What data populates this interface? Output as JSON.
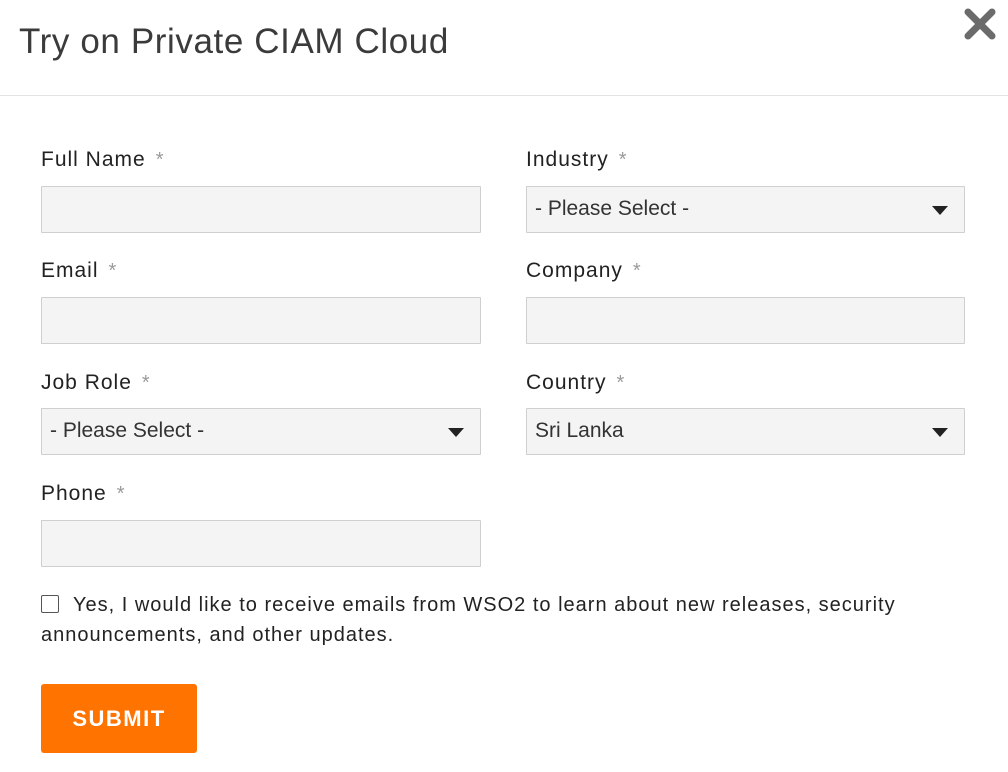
{
  "modal": {
    "title": "Try on Private CIAM Cloud",
    "close_icon": "close-icon"
  },
  "form": {
    "required_marker": "*",
    "full_name": {
      "label": "Full Name",
      "value": "",
      "placeholder": ""
    },
    "email": {
      "label": "Email",
      "value": "",
      "placeholder": ""
    },
    "job_role": {
      "label": "Job Role",
      "selected": "- Please Select -"
    },
    "phone": {
      "label": "Phone",
      "value": "",
      "placeholder": ""
    },
    "industry": {
      "label": "Industry",
      "selected": "- Please Select -"
    },
    "company": {
      "label": "Company",
      "value": "",
      "placeholder": ""
    },
    "country": {
      "label": "Country",
      "selected": "Sri Lanka"
    },
    "consent": {
      "checked": false,
      "text": "Yes, I would like to receive emails from WSO2 to learn about new releases, security announcements, and other updates."
    },
    "submit_label": "SUBMIT"
  },
  "colors": {
    "accent": "#ff7300",
    "input_bg": "#f4f4f4",
    "input_border": "#cfcfcf",
    "required_marker": "#9a9a9a"
  }
}
